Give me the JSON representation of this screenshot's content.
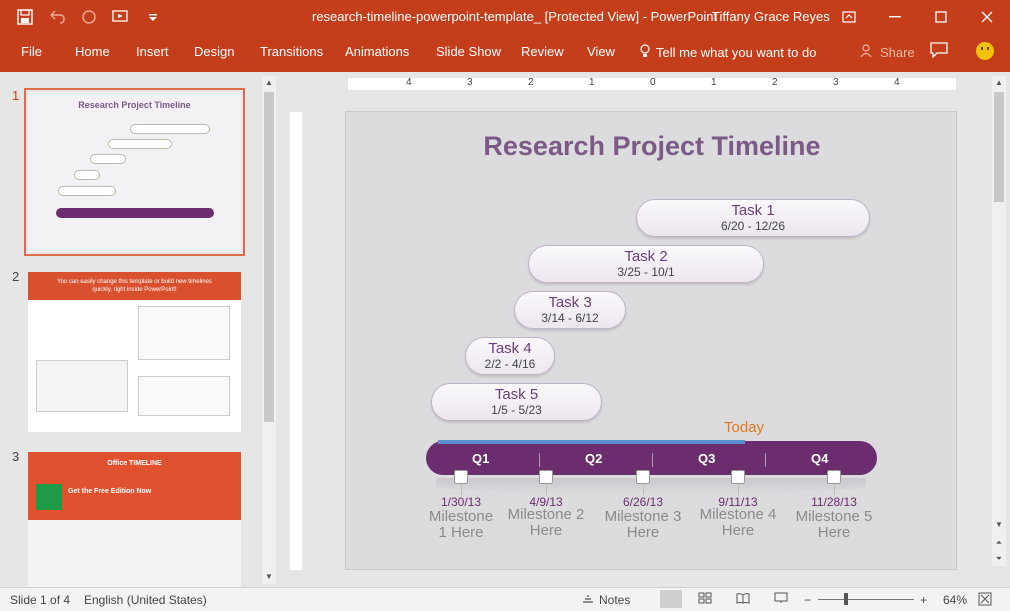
{
  "titlebar": {
    "document_title": "research-timeline-powerpoint-template_ [Protected View]  -  PowerPoint",
    "user_name": "Tiffany Grace Reyes"
  },
  "ribbon": {
    "tabs": [
      "File",
      "Home",
      "Insert",
      "Design",
      "Transitions",
      "Animations",
      "Slide Show",
      "Review",
      "View"
    ],
    "tell_me": "Tell me what you want to do",
    "share": "Share"
  },
  "thumbnails": {
    "numbers": [
      "1",
      "2",
      "3"
    ],
    "slide1_title": "Research Project Timeline",
    "slide2_heading": "You can easily change this template or build new timelines quickly, right inside PowerPoint!",
    "slide3_heading": "Get the Free Edition Now",
    "slide3_brand": "Office TIMELINE"
  },
  "ruler": {
    "h_labels": [
      "4",
      "3",
      "2",
      "1",
      "0",
      "1",
      "2",
      "3",
      "4"
    ]
  },
  "slide": {
    "title": "Research Project Timeline",
    "tasks": [
      {
        "name": "Task 1",
        "dates": "6/20 - 12/26"
      },
      {
        "name": "Task 2",
        "dates": "3/25 - 10/1"
      },
      {
        "name": "Task 3",
        "dates": "3/14 - 6/12"
      },
      {
        "name": "Task 4",
        "dates": "2/2 - 4/16"
      },
      {
        "name": "Task 5",
        "dates": "1/5 - 5/23"
      }
    ],
    "today_label": "Today",
    "quarters": [
      "Q1",
      "Q2",
      "Q3",
      "Q4"
    ],
    "milestones": [
      {
        "date": "1/30/13",
        "label_line1": "Milestone",
        "label_line2": "1 Here"
      },
      {
        "date": "4/9/13",
        "label_line1": "Milestone 2",
        "label_line2": "Here"
      },
      {
        "date": "6/26/13",
        "label_line1": "Milestone 3",
        "label_line2": "Here"
      },
      {
        "date": "9/11/13",
        "label_line1": "Milestone 4",
        "label_line2": "Here"
      },
      {
        "date": "11/28/13",
        "label_line1": "Milestone 5",
        "label_line2": "Here"
      }
    ]
  },
  "statusbar": {
    "slide_info": "Slide 1 of 4",
    "language": "English (United States)",
    "notes": "Notes",
    "zoom": "64%"
  },
  "colors": {
    "accent": "#c43e1c",
    "timeline_bar": "#6b2d6e",
    "title_purple": "#7b5a86",
    "today_orange": "#e07a20"
  }
}
